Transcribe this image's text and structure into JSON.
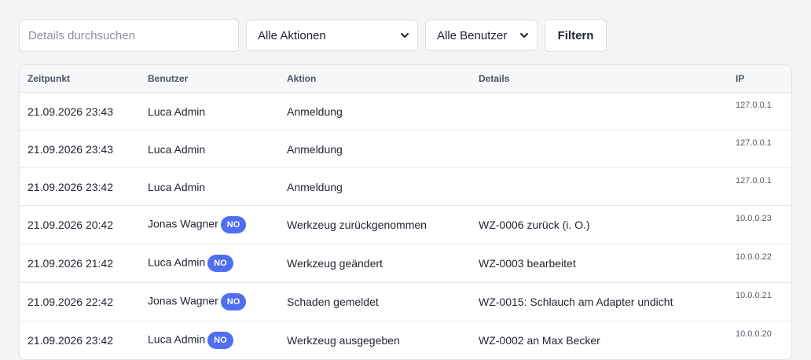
{
  "filters": {
    "search_placeholder": "Details durchsuchen",
    "search_value": "",
    "action_select": "Alle Aktionen",
    "user_select": "Alle Benutzer",
    "filter_button": "Filtern"
  },
  "table": {
    "headers": {
      "time": "Zeitpunkt",
      "user": "Benutzer",
      "action": "Aktion",
      "details": "Details",
      "ip": "IP"
    },
    "rows": [
      {
        "time": "21.09.2026 23:43",
        "user": "Luca Admin",
        "badge": "",
        "action": "Anmeldung",
        "details": "",
        "ip": "127.0.0.1"
      },
      {
        "time": "21.09.2026 23:43",
        "user": "Luca Admin",
        "badge": "",
        "action": "Anmeldung",
        "details": "",
        "ip": "127.0.0.1"
      },
      {
        "time": "21.09.2026 23:42",
        "user": "Luca Admin",
        "badge": "",
        "action": "Anmeldung",
        "details": "",
        "ip": "127.0.0.1"
      },
      {
        "time": "21.09.2026 20:42",
        "user": "Jonas Wagner",
        "badge": "NO",
        "action": "Werkzeug zurückgenommen",
        "details": "WZ-0006 zurück (i. O.)",
        "ip": "10.0.0.23"
      },
      {
        "time": "21.09.2026 21:42",
        "user": "Luca Admin",
        "badge": "NO",
        "action": "Werkzeug geändert",
        "details": "WZ-0003 bearbeitet",
        "ip": "10.0.0.22"
      },
      {
        "time": "21.09.2026 22:42",
        "user": "Jonas Wagner",
        "badge": "NO",
        "action": "Schaden gemeldet",
        "details": "WZ-0015: Schlauch am Adapter undicht",
        "ip": "10.0.0.21"
      },
      {
        "time": "21.09.2026 23:42",
        "user": "Luca Admin",
        "badge": "NO",
        "action": "Werkzeug ausgegeben",
        "details": "WZ-0002 an Max Becker",
        "ip": "10.0.0.20"
      }
    ]
  },
  "colors": {
    "background": "#f3f4f6",
    "badge": "#4f6ff0",
    "text": "#1f2430"
  }
}
